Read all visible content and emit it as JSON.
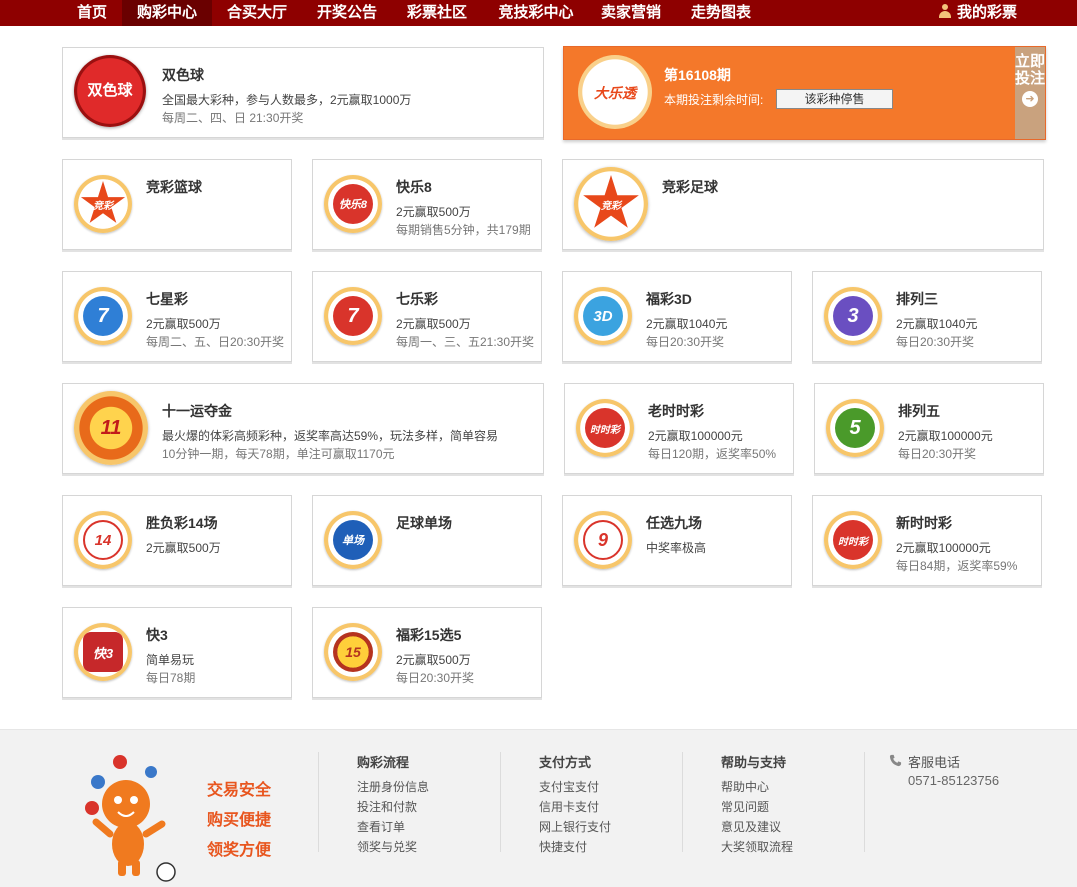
{
  "nav": {
    "items": [
      "首页",
      "购彩中心",
      "合买大厅",
      "开奖公告",
      "彩票社区",
      "竞技彩中心",
      "卖家营销",
      "走势图表"
    ],
    "active": "购彩中心",
    "my_lottery": "我的彩票"
  },
  "promo": {
    "logo_text": "大乐透",
    "issue": "第16108期",
    "remain_label": "本期投注剩余时间:",
    "stop_button": "该彩种停售",
    "buy_now": "立即投注"
  },
  "lotteries": [
    {
      "id": "ssq",
      "name": "双色球",
      "desc": "全国最大彩种，参与人数最多，2元赢取1000万",
      "sub": "每周二、四、日 21:30开奖",
      "logo_text": "双色球",
      "color": "#d42020"
    },
    {
      "id": "jclq",
      "name": "竞彩篮球",
      "desc": "",
      "sub": "",
      "logo_text": "竞彩",
      "color": "#e8481a"
    },
    {
      "id": "kl8",
      "name": "快乐8",
      "desc": "2元赢取500万",
      "sub": "每期销售5分钟，共179期",
      "logo_text": "快乐8",
      "color": "#d9342b"
    },
    {
      "id": "jczq",
      "name": "竞彩足球",
      "desc": "",
      "sub": "",
      "logo_text": "竞彩",
      "color": "#e8481a"
    },
    {
      "id": "qxc",
      "name": "七星彩",
      "desc": "2元赢取500万",
      "sub": "每周二、五、日20:30开奖",
      "logo_text": "7",
      "color": "#2f7fd6"
    },
    {
      "id": "qlc",
      "name": "七乐彩",
      "desc": "2元赢取500万",
      "sub": "每周一、三、五21:30开奖",
      "logo_text": "7",
      "color": "#d9342b"
    },
    {
      "id": "fc3d",
      "name": "福彩3D",
      "desc": "2元赢取1040元",
      "sub": "每日20:30开奖",
      "logo_text": "3D",
      "color": "#3ba3e0"
    },
    {
      "id": "pl3",
      "name": "排列三",
      "desc": "2元赢取1040元",
      "sub": "每日20:30开奖",
      "logo_text": "3",
      "color": "#6a4fc1"
    },
    {
      "id": "syydj",
      "name": "十一运夺金",
      "desc": "最火爆的体彩高频彩种，返奖率高达59%，玩法多样，简单容易",
      "sub": "10分钟一期，每天78期，单注可赢取1170元",
      "logo_text": "11",
      "color": "#e86a1a"
    },
    {
      "id": "lssc",
      "name": "老时时彩",
      "desc": "2元赢取100000元",
      "sub": "每日120期，返奖率50%",
      "logo_text": "时时彩",
      "color": "#d9342b"
    },
    {
      "id": "pl5",
      "name": "排列五",
      "desc": "2元赢取100000元",
      "sub": "每日20:30开奖",
      "logo_text": "5",
      "color": "#4a9a2a"
    },
    {
      "id": "sfc14",
      "name": "胜负彩14场",
      "desc": "2元赢取500万",
      "sub": "",
      "logo_text": "14",
      "color": "#d9342b"
    },
    {
      "id": "zqdc",
      "name": "足球单场",
      "desc": "",
      "sub": "",
      "logo_text": "单场",
      "color": "#1f5fb8"
    },
    {
      "id": "rx9",
      "name": "任选九场",
      "desc": "中奖率极高",
      "sub": "",
      "logo_text": "9",
      "color": "#d9342b"
    },
    {
      "id": "xssc",
      "name": "新时时彩",
      "desc": "2元赢取100000元",
      "sub": "每日84期，返奖率59%",
      "logo_text": "时时彩",
      "color": "#d9342b"
    },
    {
      "id": "k3",
      "name": "快3",
      "desc": "简单易玩",
      "sub": "每日78期",
      "logo_text": "快3",
      "color": "#c6282a"
    },
    {
      "id": "fc15x5",
      "name": "福彩15选5",
      "desc": "2元赢取500万",
      "sub": "每日20:30开奖",
      "logo_text": "15",
      "color": "#b5331f"
    }
  ],
  "footer": {
    "slogans": [
      "交易安全",
      "购买便捷",
      "领奖方便"
    ],
    "columns": [
      {
        "title": "购彩流程",
        "links": [
          "注册身份信息",
          "投注和付款",
          "查看订单",
          "领奖与兑奖"
        ]
      },
      {
        "title": "支付方式",
        "links": [
          "支付宝支付",
          "信用卡支付",
          "网上银行支付",
          "快捷支付"
        ]
      },
      {
        "title": "帮助与支持",
        "links": [
          "帮助中心",
          "常见问题",
          "意见及建议",
          "大奖领取流程"
        ]
      }
    ],
    "service_label": "客服电话",
    "service_phone": "0571-85123756"
  }
}
